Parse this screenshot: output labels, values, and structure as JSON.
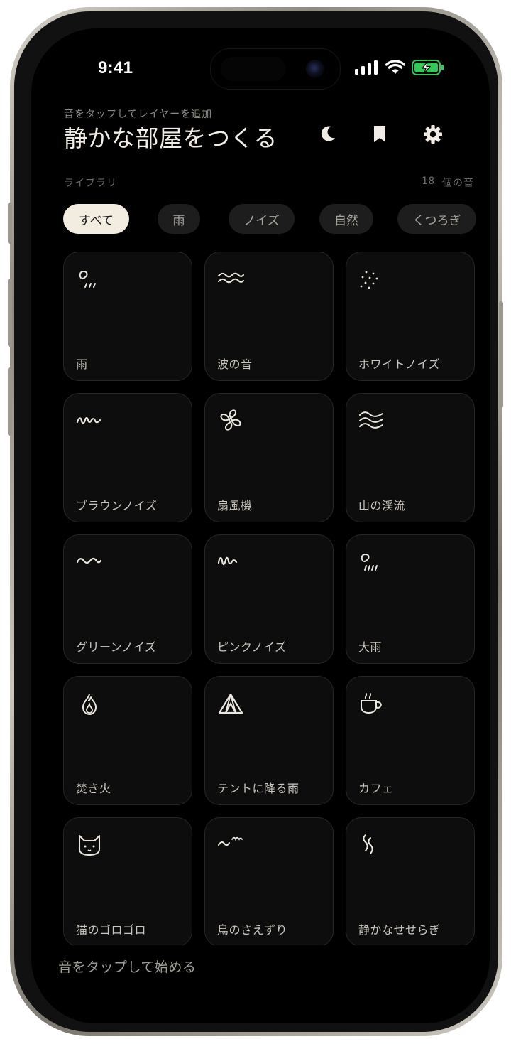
{
  "status": {
    "time": "9:41",
    "battery_color": "#34c759"
  },
  "header": {
    "subtitle": "音をタップしてレイヤーを追加",
    "title": "静かな部屋をつくる",
    "icons": [
      "moon-icon",
      "bookmark-icon",
      "gear-icon"
    ]
  },
  "library": {
    "label": "ライブラリ",
    "count": "18",
    "count_suffix": "個の音"
  },
  "filters": [
    {
      "label": "すべて",
      "active": true
    },
    {
      "label": "雨",
      "active": false
    },
    {
      "label": "ノイズ",
      "active": false
    },
    {
      "label": "自然",
      "active": false
    },
    {
      "label": "くつろぎ",
      "active": false
    }
  ],
  "sounds": [
    {
      "label": "雨",
      "icon": "rain-icon"
    },
    {
      "label": "波の音",
      "icon": "waves-icon"
    },
    {
      "label": "ホワイトノイズ",
      "icon": "sparkle-dots-icon"
    },
    {
      "label": "ブラウンノイズ",
      "icon": "squiggle-icon"
    },
    {
      "label": "扇風機",
      "icon": "fan-icon"
    },
    {
      "label": "山の渓流",
      "icon": "stream-icon"
    },
    {
      "label": "グリーンノイズ",
      "icon": "wave-line-icon"
    },
    {
      "label": "ピンクノイズ",
      "icon": "pink-wave-icon"
    },
    {
      "label": "大雨",
      "icon": "heavy-rain-icon"
    },
    {
      "label": "焚き火",
      "icon": "fire-icon"
    },
    {
      "label": "テントに降る雨",
      "icon": "tent-icon"
    },
    {
      "label": "カフェ",
      "icon": "coffee-cup-icon"
    },
    {
      "label": "猫のゴロゴロ",
      "icon": "cat-icon"
    },
    {
      "label": "鳥のさえずり",
      "icon": "bird-icon"
    },
    {
      "label": "静かなせせらぎ",
      "icon": "ripple-icon"
    }
  ],
  "footer": {
    "text": "音をタップして始める"
  }
}
